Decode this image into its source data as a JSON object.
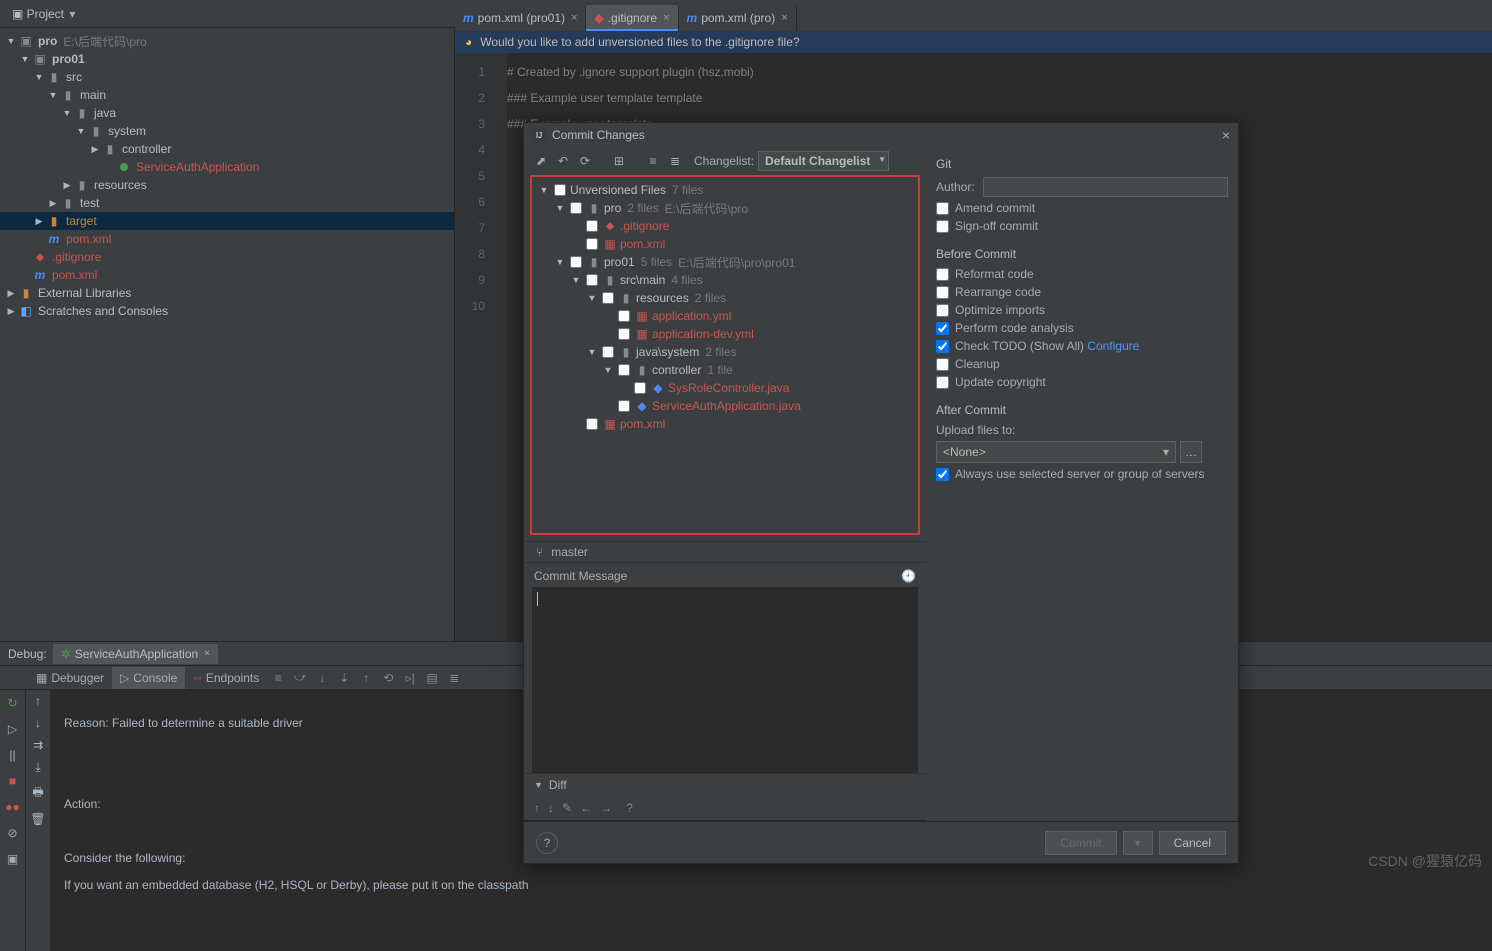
{
  "toolbar": {
    "project_label": "Project"
  },
  "project_path_label": "E:\\后端代码\\pro",
  "tabs": [
    {
      "label": "pom.xml (pro01)",
      "icon": "m",
      "active": false
    },
    {
      "label": ".gitignore",
      "icon": "g",
      "active": true
    },
    {
      "label": "pom.xml (pro)",
      "icon": "m",
      "active": false
    }
  ],
  "notification": "Would you like to add unversioned files to the .gitignore file?",
  "tree": {
    "root": "pro",
    "nodes": {
      "pro01": "pro01",
      "src": "src",
      "main": "main",
      "java": "java",
      "system": "system",
      "controller": "controller",
      "svc": "ServiceAuthApplication",
      "resources": "resources",
      "test": "test",
      "target": "target",
      "pomxml": "pom.xml",
      "gitignore": ".gitignore",
      "pomxml2": "pom.xml",
      "extlib": "External Libraries",
      "scratches": "Scratches and Consoles"
    }
  },
  "editor": {
    "lines": [
      "# Created by .ignore support plugin (hsz.mobi)",
      "### Example user template template",
      "### Example user template"
    ],
    "lineNumbers": [
      "1",
      "2",
      "3",
      "4",
      "5",
      "6",
      "7",
      "8",
      "9",
      "10"
    ]
  },
  "debug": {
    "title": "Debug:",
    "session": "ServiceAuthApplication",
    "subtabs": {
      "debugger": "Debugger",
      "console": "Console",
      "endpoints": "Endpoints"
    },
    "console_lines": {
      "l1": "Reason: Failed to determine a suitable driver",
      "l2": "Action:",
      "l3": "Consider the following:",
      "l4": "  If you want an embedded database (H2, HSQL or Derby), please put it on the classpath"
    }
  },
  "dialog": {
    "title": "Commit Changes",
    "changelist_label": "Changelist:",
    "changelist_value": "Default Changelist",
    "tree": {
      "unversioned": "Unversioned Files",
      "unversioned_meta": "7 files",
      "pro": "pro",
      "pro_meta": "2 files",
      "pro_path": "E:\\后端代码\\pro",
      "gitignore": ".gitignore",
      "pomxml": "pom.xml",
      "pro01": "pro01",
      "pro01_meta": "5 files",
      "pro01_path": "E:\\后端代码\\pro\\pro01",
      "srcmain": "src\\main",
      "srcmain_meta": "4 files",
      "resources": "resources",
      "resources_meta": "2 files",
      "appyml": "application.yml",
      "appdevyml": "application-dev.yml",
      "javasys": "java\\system",
      "javasys_meta": "2 files",
      "controller": "controller",
      "controller_meta": "1 file",
      "sysrole": "SysRoleController.java",
      "svcauth": "ServiceAuthApplication.java",
      "pomxml2": "pom.xml"
    },
    "branch": "master",
    "commit_msg_label": "Commit Message",
    "diff_label": "Diff",
    "right": {
      "git": "Git",
      "author": "Author:",
      "amend": "Amend commit",
      "signoff": "Sign-off commit",
      "before": "Before Commit",
      "reformat": "Reformat code",
      "rearrange": "Rearrange code",
      "optimize": "Optimize imports",
      "analysis": "Perform code analysis",
      "todo": "Check TODO (Show All)",
      "configure": "Configure",
      "cleanup": "Cleanup",
      "copyright": "Update copyright",
      "after": "After Commit",
      "upload": "Upload files to:",
      "upload_value": "<None>",
      "always": "Always use selected server or group of servers"
    },
    "footer": {
      "commit": "Commit",
      "cancel": "Cancel"
    }
  },
  "watermark": "CSDN @猩猿亿码"
}
